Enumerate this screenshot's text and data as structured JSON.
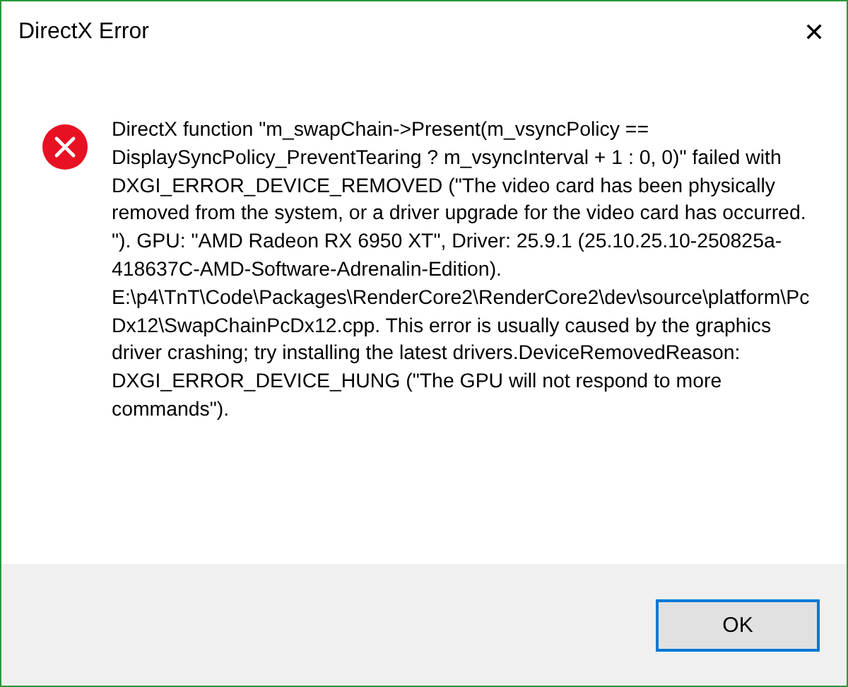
{
  "window": {
    "title": "DirectX Error",
    "close": "✕"
  },
  "message": "DirectX function \"m_swapChain->Present(m_vsyncPolicy == DisplaySyncPolicy_PreventTearing ? m_vsyncInterval + 1 : 0, 0)\" failed with DXGI_ERROR_DEVICE_REMOVED (\"The video card has been physically removed from the system, or a driver upgrade for the video card has occurred. \"). GPU: \"AMD Radeon RX 6950 XT\", Driver: 25.9.1 (25.10.25.10-250825a-418637C-AMD-Software-Adrenalin-Edition). E:\\p4\\TnT\\Code\\Packages\\RenderCore2\\RenderCore2\\dev\\source\\platform\\PcDx12\\SwapChainPcDx12.cpp. This error is usually caused by the graphics driver crashing; try installing the latest drivers.DeviceRemovedReason: DXGI_ERROR_DEVICE_HUNG (\"The GPU will not respond to more commands\").",
  "buttons": [
    "OK"
  ]
}
